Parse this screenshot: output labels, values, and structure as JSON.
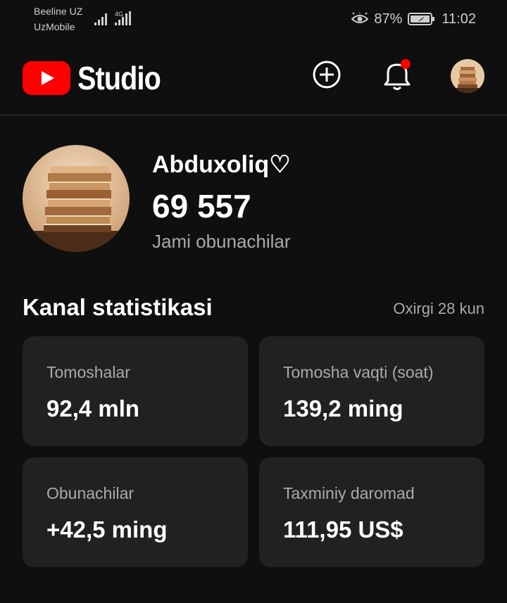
{
  "status_bar": {
    "carrier_1": "Beeline UZ",
    "carrier_2": "UzMobile",
    "network_type": "4G",
    "battery_percent": "87%",
    "time": "11:02",
    "icons": [
      "signal-icon",
      "eye-comfort-icon",
      "battery-icon"
    ]
  },
  "app_bar": {
    "logo_word": "Studio",
    "icons": [
      "youtube-logo-icon",
      "create-icon",
      "notifications-bell-icon"
    ],
    "notification_dot_color": "#ff0000"
  },
  "channel": {
    "name": "Abduxoliq♡",
    "subscriber_count": "69 557",
    "subscriber_label": "Jami obunachilar"
  },
  "stats": {
    "title": "Kanal statistikasi",
    "period": "Oxirgi 28 kun",
    "cards": [
      {
        "label": "Tomoshalar",
        "value": "92,4 mln"
      },
      {
        "label": "Tomosha vaqti (soat)",
        "value": "139,2 ming"
      },
      {
        "label": "Obunachilar",
        "value": "+42,5 ming"
      },
      {
        "label": "Taxminiy daromad",
        "value": "111,95 US$"
      }
    ]
  },
  "colors": {
    "background": "#0f0f0f",
    "card": "#212121",
    "brand_red": "#ff0000",
    "secondary_text": "#aaaaaa"
  }
}
